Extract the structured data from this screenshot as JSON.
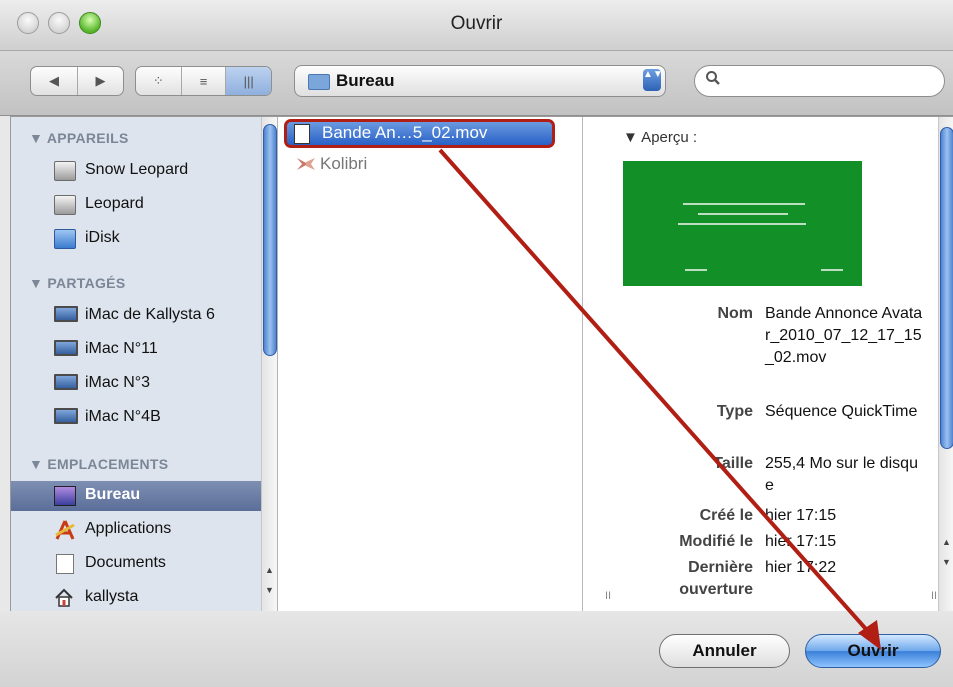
{
  "window": {
    "title": "Ouvrir"
  },
  "toolbar": {
    "nav_back": "◀",
    "nav_forward": "▶",
    "view_icons": "⁘",
    "view_list": "≡",
    "view_columns": "|||",
    "location": "Bureau",
    "popup_arrows": "▲▼",
    "search_placeholder": ""
  },
  "sidebar": {
    "sections": [
      {
        "title": "▼ APPAREILS"
      },
      {
        "title": "▼ PARTAGÉS"
      },
      {
        "title": "▼ EMPLACEMENTS"
      }
    ],
    "devices": [
      {
        "label": "Snow Leopard",
        "icon": "hard-disk-icon"
      },
      {
        "label": "Leopard",
        "icon": "hard-disk-icon"
      },
      {
        "label": "iDisk",
        "icon": "idisk-icon"
      }
    ],
    "shared": [
      {
        "label": "iMac de Kallysta 6",
        "icon": "imac-icon"
      },
      {
        "label": "iMac N°11",
        "icon": "imac-icon"
      },
      {
        "label": "iMac N°3",
        "icon": "imac-icon"
      },
      {
        "label": "iMac N°4B",
        "icon": "imac-icon"
      }
    ],
    "places": [
      {
        "label": "Bureau",
        "icon": "desktop-icon",
        "selected": true
      },
      {
        "label": "Applications",
        "icon": "applications-icon"
      },
      {
        "label": "Documents",
        "icon": "document-icon"
      },
      {
        "label": "kallysta",
        "icon": "home-icon"
      }
    ]
  },
  "files": [
    {
      "name": "Bande An…5_02.mov",
      "icon": "movie-file-icon",
      "selected": true
    },
    {
      "name": "Kolibri",
      "icon": "kolibri-app-icon",
      "selected": false
    }
  ],
  "preview": {
    "header": "▼ Aperçu :",
    "fields": [
      {
        "key": "Nom",
        "value": "Bande Annonce Avatar_2010_07_12_17_15_02.mov"
      },
      {
        "key": "Type",
        "value": "Séquence QuickTime"
      },
      {
        "key": "Taille",
        "value": "255,4 Mo sur le disque"
      },
      {
        "key": "Créé le",
        "value": "hier 17:15"
      },
      {
        "key": "Modifié le",
        "value": "hier 17:15"
      },
      {
        "key": "Dernière ouverture",
        "value": "hier 17:22"
      }
    ]
  },
  "buttons": {
    "cancel": "Annuler",
    "open": "Ouvrir"
  },
  "colors": {
    "selection": "#3d76d4",
    "annotation": "#b01e14",
    "preview_bg": "#138f27"
  }
}
